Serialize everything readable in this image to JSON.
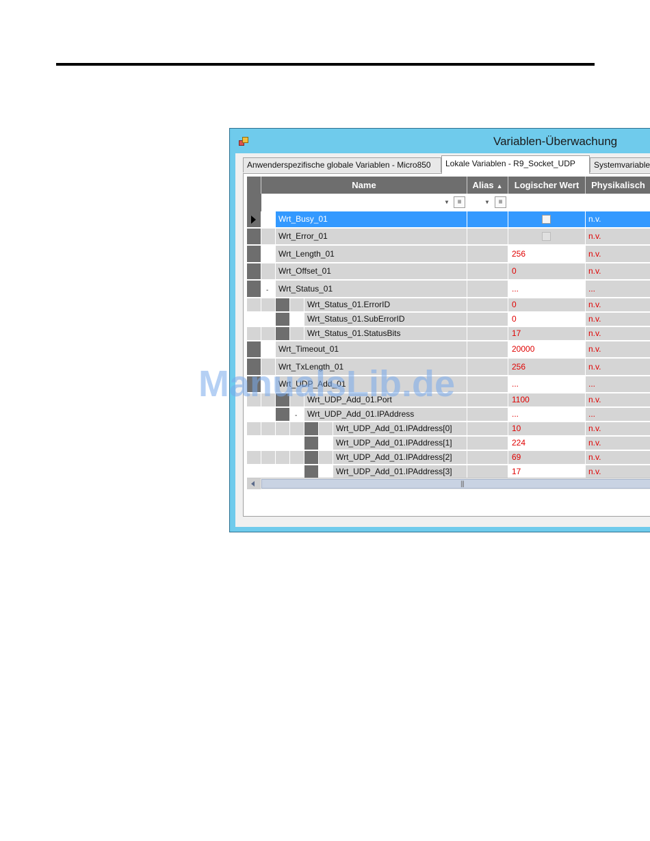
{
  "window": {
    "title": "Variablen-Überwachung"
  },
  "tabs": [
    {
      "label": "Anwenderspezifische globale Variablen - Micro850",
      "active": false
    },
    {
      "label": "Lokale Variablen - R9_Socket_UDP",
      "active": true
    },
    {
      "label": "Systemvariablen",
      "active": false
    }
  ],
  "grid": {
    "columns": [
      {
        "label": "Name"
      },
      {
        "label": "Alias",
        "sort": "ascending"
      },
      {
        "label": "Logischer Wert"
      },
      {
        "label": "Physikalisch"
      }
    ],
    "rows": [
      {
        "name": "Wrt_Busy_01",
        "value": "",
        "checkbox": true,
        "physical": "n.v.",
        "selected": true
      },
      {
        "name": "Wrt_Error_01",
        "value": "",
        "checkbox": true,
        "physical": "n.v."
      },
      {
        "name": "Wrt_Length_01",
        "value": "256",
        "physical": "n.v."
      },
      {
        "name": "Wrt_Offset_01",
        "value": "0",
        "physical": "n.v."
      },
      {
        "name": "Wrt_Status_01",
        "value": "...",
        "physical": "...",
        "expanded": true
      },
      {
        "name": "Wrt_Status_01.ErrorID",
        "value": "0",
        "physical": "n.v."
      },
      {
        "name": "Wrt_Status_01.SubErrorID",
        "value": "0",
        "physical": "n.v."
      },
      {
        "name": "Wrt_Status_01.StatusBits",
        "value": "17",
        "physical": "n.v."
      },
      {
        "name": "Wrt_Timeout_01",
        "value": "20000",
        "physical": "n.v."
      },
      {
        "name": "Wrt_TxLength_01",
        "value": "256",
        "physical": "n.v."
      },
      {
        "name": "Wrt_UDP_Add_01",
        "value": "...",
        "physical": "..."
      },
      {
        "name": "Wrt_UDP_Add_01.Port",
        "value": "1100",
        "physical": "n.v."
      },
      {
        "name": "Wrt_UDP_Add_01.IPAddress",
        "value": "...",
        "physical": "...",
        "expanded": true
      },
      {
        "name": "Wrt_UDP_Add_01.IPAddress[0]",
        "value": "10",
        "physical": "n.v."
      },
      {
        "name": "Wrt_UDP_Add_01.IPAddress[1]",
        "value": "224",
        "physical": "n.v."
      },
      {
        "name": "Wrt_UDP_Add_01.IPAddress[2]",
        "value": "69",
        "physical": "n.v."
      },
      {
        "name": "Wrt_UDP_Add_01.IPAddress[3]",
        "value": "17",
        "physical": "n.v."
      }
    ]
  },
  "watermark": "ManualsLib.de",
  "colors": {
    "selection": "#3399ff",
    "value_text": "#e00000",
    "title_bar": "#6fcbec"
  }
}
